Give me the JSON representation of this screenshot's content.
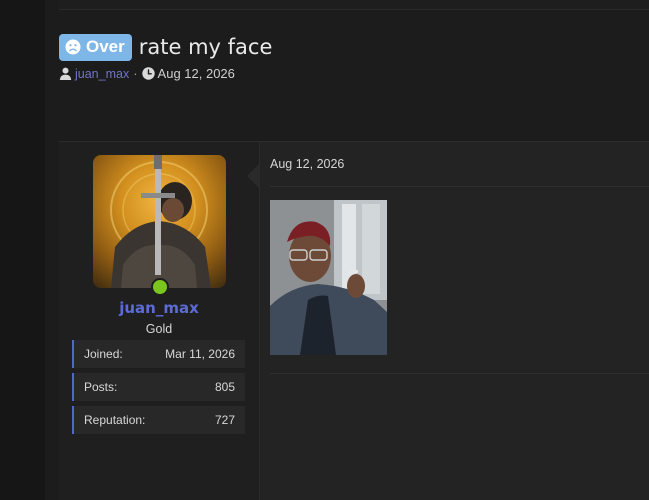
{
  "thread": {
    "prefix": "Over",
    "title": "rate my face",
    "author": "juan_max",
    "date": "Aug 12, 2026"
  },
  "post": {
    "date": "Aug 12, 2026",
    "user": {
      "name": "juan_max",
      "rank": "Gold",
      "stats": [
        {
          "label": "Joined:",
          "value": "Mar 11, 2026"
        },
        {
          "label": "Posts:",
          "value": "805"
        },
        {
          "label": "Reputation:",
          "value": "727"
        }
      ]
    }
  },
  "colors": {
    "prefix_badge": "#7fb6e8",
    "username": "#5d6bd6",
    "online": "#7ac61f",
    "stat_accent": "#5366c9"
  },
  "icons": {
    "prefix": "sad-face-icon",
    "author": "user-icon",
    "date": "clock-icon"
  }
}
